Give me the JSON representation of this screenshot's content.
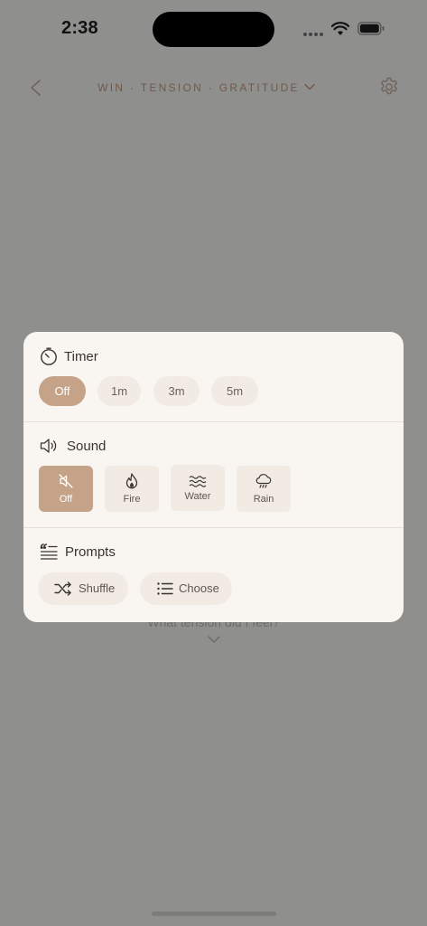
{
  "status_bar": {
    "time": "2:38"
  },
  "nav": {
    "title": "WIN · TENSION · GRATITUDE",
    "icons": {
      "back": "chevron-left-icon",
      "dropdown": "chevron-down-icon",
      "settings": "gear-icon"
    }
  },
  "background": {
    "prompt_text": "What tension did I feel?"
  },
  "panel": {
    "timer": {
      "title": "Timer",
      "options": [
        "Off",
        "1m",
        "3m",
        "5m"
      ],
      "selected": "Off"
    },
    "sound": {
      "title": "Sound",
      "options": [
        {
          "label": "Off",
          "icon": "sound-off-icon"
        },
        {
          "label": "Fire",
          "icon": "fire-icon"
        },
        {
          "label": "Water",
          "icon": "waves-icon"
        },
        {
          "label": "Rain",
          "icon": "rain-cloud-icon"
        }
      ],
      "selected": "Off"
    },
    "prompts": {
      "title": "Prompts",
      "actions": [
        {
          "label": "Shuffle",
          "icon": "shuffle-icon"
        },
        {
          "label": "Choose",
          "icon": "list-icon"
        }
      ]
    }
  },
  "colors": {
    "accent": "#c4a388",
    "card_bg": "#f9f5f1",
    "chip_bg": "#f1ebe4",
    "overlay_bg": "#8f8f8d",
    "nav_text": "#6e5a4c"
  }
}
